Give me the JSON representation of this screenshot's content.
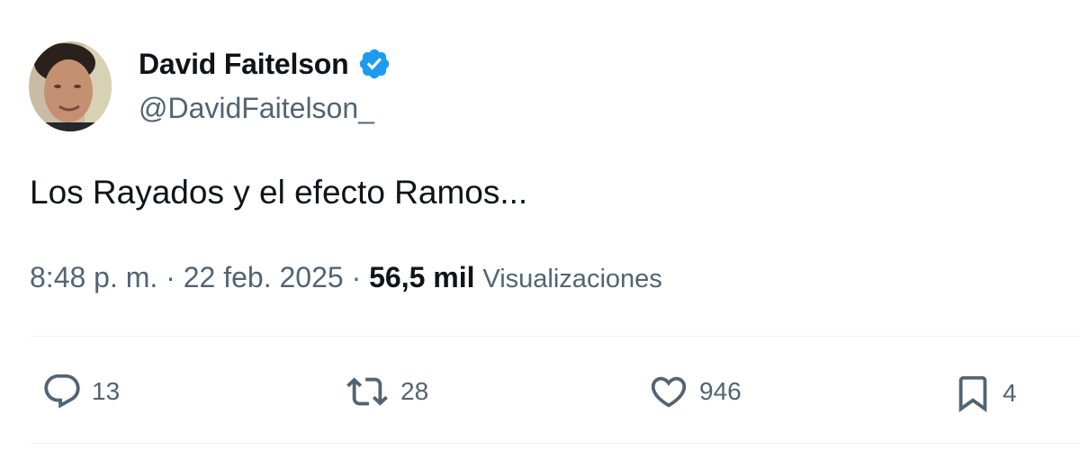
{
  "author": {
    "display_name": "David Faitelson",
    "handle": "@DavidFaitelson_",
    "verified_color": "#1d9bf0"
  },
  "tweet": {
    "text": "Los Rayados y el efecto Ramos...",
    "time": "8:48 p. m.",
    "separator": "·",
    "date": "22 feb. 2025",
    "views_count": "56,5 mil",
    "views_label": "Visualizaciones"
  },
  "actions": {
    "reply": {
      "icon": "reply-icon",
      "count": "13"
    },
    "retweet": {
      "icon": "retweet-icon",
      "count": "28"
    },
    "like": {
      "icon": "heart-icon",
      "count": "946"
    },
    "bookmark": {
      "icon": "bookmark-icon",
      "count": "4"
    }
  },
  "colors": {
    "text_primary": "#0f1419",
    "text_secondary": "#536471",
    "divider": "#eff3f4"
  }
}
